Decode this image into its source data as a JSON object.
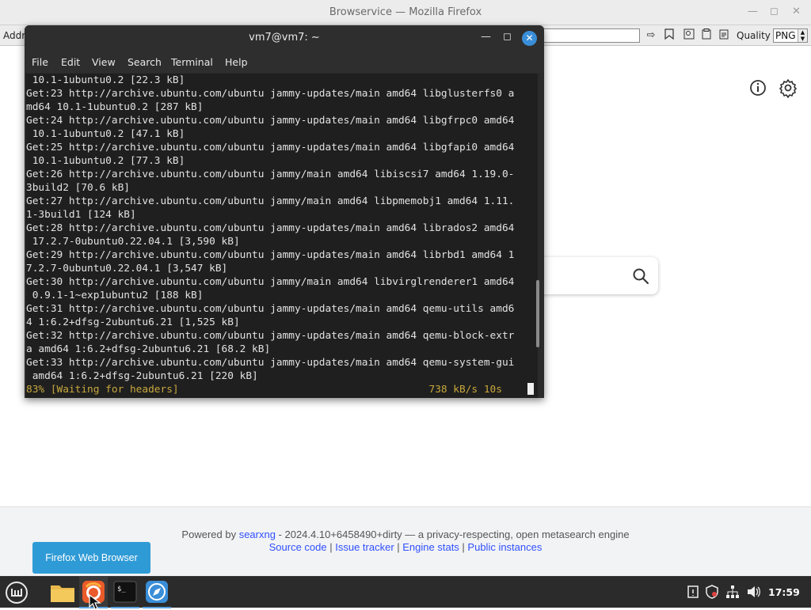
{
  "firefox": {
    "window_title": "Browservice — Mozilla Firefox",
    "address_label": "Addr",
    "quality_label": "Quality",
    "format_value": "PNG"
  },
  "terminal": {
    "title": "vm7@vm7: ~",
    "menu": [
      "File",
      "Edit",
      "View",
      "Search",
      "Terminal",
      "Help"
    ],
    "lines": [
      " 10.1-1ubuntu0.2 [22.3 kB]",
      "Get:23 http://archive.ubuntu.com/ubuntu jammy-updates/main amd64 libglusterfs0 a",
      "md64 10.1-1ubuntu0.2 [287 kB]",
      "Get:24 http://archive.ubuntu.com/ubuntu jammy-updates/main amd64 libgfrpc0 amd64",
      " 10.1-1ubuntu0.2 [47.1 kB]",
      "Get:25 http://archive.ubuntu.com/ubuntu jammy-updates/main amd64 libgfapi0 amd64",
      " 10.1-1ubuntu0.2 [77.3 kB]",
      "Get:26 http://archive.ubuntu.com/ubuntu jammy/main amd64 libiscsi7 amd64 1.19.0-",
      "3build2 [70.6 kB]",
      "Get:27 http://archive.ubuntu.com/ubuntu jammy/main amd64 libpmemobj1 amd64 1.11.",
      "1-3build1 [124 kB]",
      "Get:28 http://archive.ubuntu.com/ubuntu jammy-updates/main amd64 librados2 amd64",
      " 17.2.7-0ubuntu0.22.04.1 [3,590 kB]",
      "Get:29 http://archive.ubuntu.com/ubuntu jammy-updates/main amd64 librbd1 amd64 1",
      "7.2.7-0ubuntu0.22.04.1 [3,547 kB]",
      "Get:30 http://archive.ubuntu.com/ubuntu jammy/main amd64 libvirglrenderer1 amd64",
      " 0.9.1-1~exp1ubuntu2 [188 kB]",
      "Get:31 http://archive.ubuntu.com/ubuntu jammy-updates/main amd64 qemu-utils amd6",
      "4 1:6.2+dfsg-2ubuntu6.21 [1,525 kB]",
      "Get:32 http://archive.ubuntu.com/ubuntu jammy-updates/main amd64 qemu-block-extr",
      "a amd64 1:6.2+dfsg-2ubuntu6.21 [68.2 kB]",
      "Get:33 http://archive.ubuntu.com/ubuntu jammy-updates/main amd64 qemu-system-gui",
      " amd64 1:6.2+dfsg-2ubuntu6.21 [220 kB]"
    ],
    "status_line": "83% [Waiting for headers]                                         738 kB/s 10s"
  },
  "page": {
    "footer_powered": "Powered by ",
    "footer_searxng": "searxng",
    "footer_rest": " - 2024.4.10+6458490+dirty — a privacy-respecting, open metasearch engine",
    "footer_links": [
      "Source code",
      "Issue tracker",
      "Engine stats",
      "Public instances"
    ],
    "footer_sep": " | "
  },
  "tooltip": "Firefox Web Browser",
  "taskbar": {
    "clock": "17:59"
  }
}
